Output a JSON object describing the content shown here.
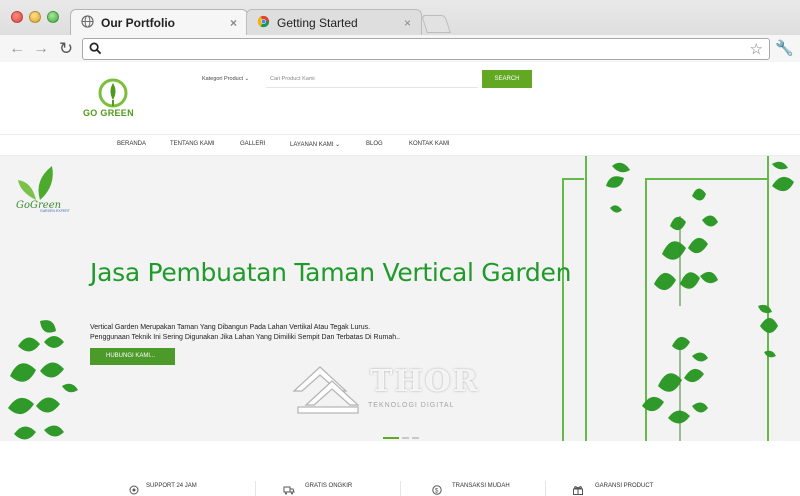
{
  "browser": {
    "tabs": [
      {
        "title": "Our Portfolio",
        "active": true,
        "icon": "globe-icon"
      },
      {
        "title": "Getting Started",
        "active": false,
        "icon": "chrome-icon"
      }
    ],
    "close_glyph": "×",
    "url": "",
    "icons": [
      "back-icon",
      "forward-icon",
      "reload-icon",
      "search-icon",
      "star-icon",
      "wrench-icon"
    ]
  },
  "header": {
    "logo_text": "GO GREEN",
    "search": {
      "category_label": "Kategori Product ⌄",
      "placeholder": "Cari Product Kami",
      "button_label": "SEARCH"
    }
  },
  "nav": {
    "items": [
      "BERANDA",
      "TENTANG KAMI",
      "GALLERI",
      "LAYANAN KAMI ⌄",
      "BLOG",
      "KONTAK KAMI"
    ]
  },
  "hero": {
    "brand": "GoGreen",
    "brand_sub": "GARDEN EXPERT",
    "title": "Jasa Pembuatan Taman Vertical Garden",
    "desc_line1": "Vertical Garden Merupakan Taman Yang Dibangun Pada Lahan Vertikal Atau Tegak Lurus.",
    "desc_line2": "Penggunaan Teknik Ini Sering Digunakan Jika Lahan Yang Dimiliki Sempit Dan Terbatas Di Rumah..",
    "button_label": "HUBUNGI KAMI...",
    "watermark": "THOR",
    "watermark_sub": "TEKNOLOGI DIGITAL",
    "slides_active": 0
  },
  "features": [
    {
      "label": "SUPPORT 24 JAM",
      "icon": "support-icon"
    },
    {
      "label": "GRATIS ONGKIR",
      "icon": "truck-icon"
    },
    {
      "label": "TRANSAKSI MUDAH",
      "icon": "money-icon"
    },
    {
      "label": "GARANSI PRODUCT",
      "icon": "gift-icon"
    }
  ],
  "colors": {
    "brand_green": "#62a823",
    "title_green": "#1f9a2b",
    "frame_green": "#65b94a"
  }
}
